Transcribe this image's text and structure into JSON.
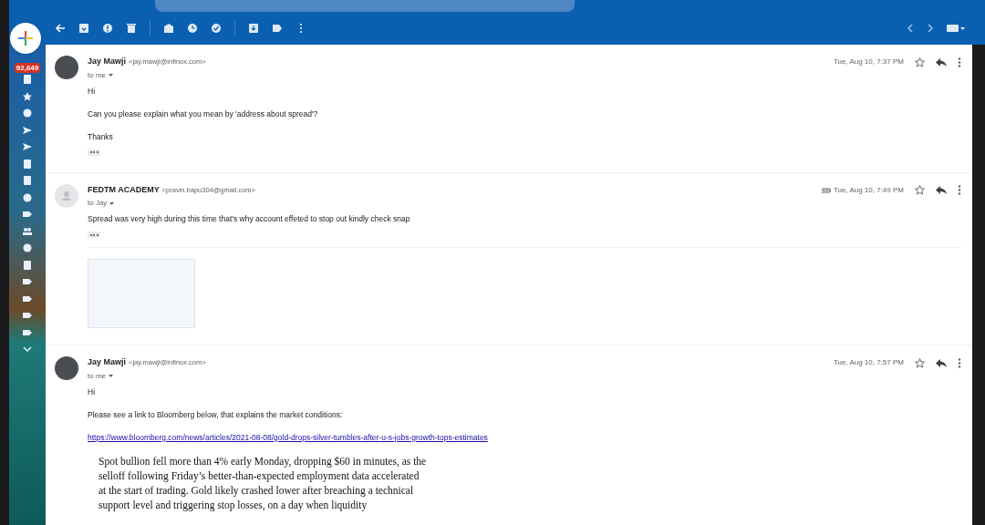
{
  "sidebar": {
    "unread_count": "92,649"
  },
  "messages": [
    {
      "sender": "Jay Mawji",
      "email": "<jay.mawji@infinox.com>",
      "recipient": "to me",
      "date": "Tue, Aug 10, 7:37 PM",
      "has_photo": true,
      "has_attachment": false,
      "starred": false,
      "body": [
        {
          "kind": "text",
          "text": "Hi"
        },
        {
          "kind": "text",
          "text": "Can you please explain what you mean by 'address about spread'?"
        },
        {
          "kind": "text",
          "text": "Thanks"
        },
        {
          "kind": "trimmed"
        }
      ]
    },
    {
      "sender": "FEDTM ACADEMY",
      "email": "<pravin.bapu304@gmail.com>",
      "recipient": "to Jay",
      "date": "Tue, Aug 10, 7:49 PM",
      "has_photo": false,
      "has_attachment": true,
      "starred": false,
      "body": [
        {
          "kind": "text",
          "text": "Spread was very high during this time that's why account effeted to stop out kindly check snap"
        },
        {
          "kind": "trimmed"
        },
        {
          "kind": "image"
        }
      ]
    },
    {
      "sender": "Jay Mawji",
      "email": "<jay.mawji@infinox.com>",
      "recipient": "to me",
      "date": "Tue, Aug 10, 7:57 PM",
      "has_photo": true,
      "has_attachment": false,
      "starred": false,
      "body": [
        {
          "kind": "text",
          "text": "Hi"
        },
        {
          "kind": "text",
          "text": "Please see a link to Bloomberg below, that explains the market conditions:"
        },
        {
          "kind": "link",
          "text": "https://www.bloomberg.com/news/articles/2021-08-08/gold-drops-silver-tumbles-after-u-s-jobs-growth-tops-estimates"
        },
        {
          "kind": "quote",
          "text": "Spot bullion fell more than 4% early Monday, dropping $60 in minutes, as the selloff following Friday’s better-than-expected employment data accelerated at the start of trading. Gold likely crashed lower after breaching a technical support level and triggering stop losses, on a day when liquidity"
        }
      ]
    }
  ]
}
